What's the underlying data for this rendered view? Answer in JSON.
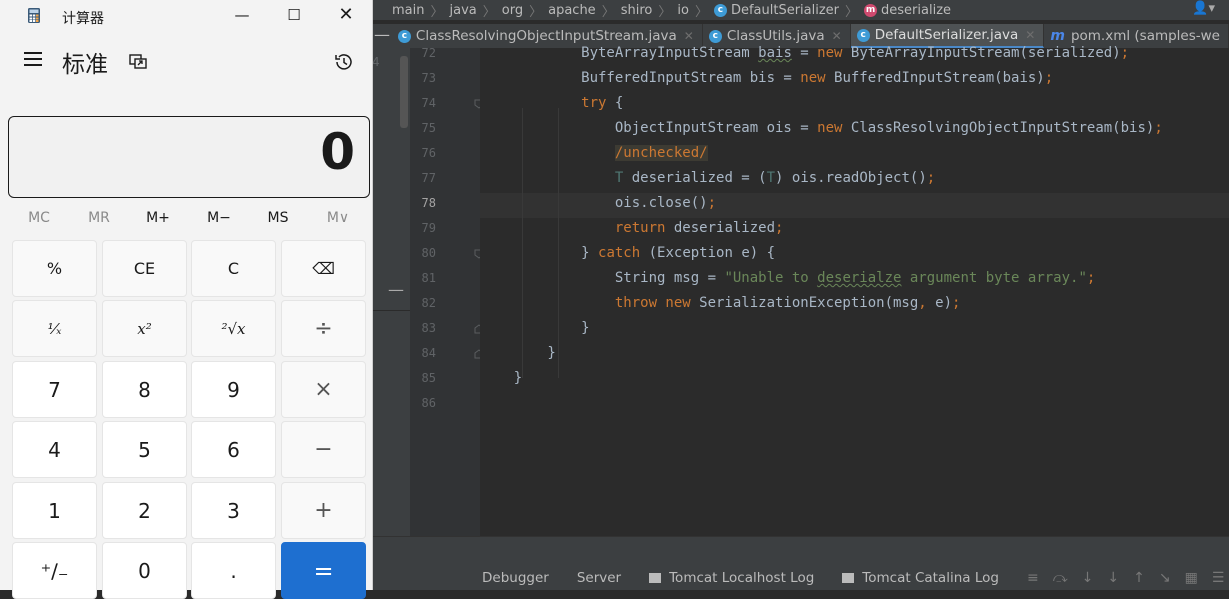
{
  "ide": {
    "breadcrumb": [
      "main",
      "java",
      "org",
      "apache",
      "shiro",
      "io",
      "DefaultSerializer",
      "deserialize"
    ],
    "left_gutter_number": "4",
    "tabs": [
      {
        "label": "ClassResolvingObjectInputStream.java",
        "icon": "class-icon",
        "active": false
      },
      {
        "label": "ClassUtils.java",
        "icon": "class-icon",
        "active": false
      },
      {
        "label": "DefaultSerializer.java",
        "icon": "class-icon",
        "active": true
      },
      {
        "label": "pom.xml (samples-we",
        "icon": "maven-icon",
        "active": false
      }
    ],
    "line_numbers": [
      "72",
      "73",
      "74",
      "75",
      "76",
      "77",
      "78",
      "79",
      "80",
      "81",
      "82",
      "83",
      "84",
      "85",
      "86"
    ],
    "current_line": "78",
    "bottom_tabs": [
      "Debugger",
      "Server",
      "Tomcat Localhost Log",
      "Tomcat Catalina Log"
    ]
  },
  "calculator": {
    "title": "计算器",
    "mode": "标准",
    "display_value": "0",
    "memory_buttons": [
      "MC",
      "MR",
      "M+",
      "M−",
      "MS",
      "M∨"
    ],
    "keys": [
      [
        "%",
        "CE",
        "C",
        "⌫"
      ],
      [
        "¹⁄ₓ",
        "x²",
        "²√x",
        "÷"
      ],
      [
        "7",
        "8",
        "9",
        "×"
      ],
      [
        "4",
        "5",
        "6",
        "−"
      ],
      [
        "1",
        "2",
        "3",
        "+"
      ],
      [
        "⁺∕₋",
        "0",
        ".",
        "="
      ]
    ]
  }
}
